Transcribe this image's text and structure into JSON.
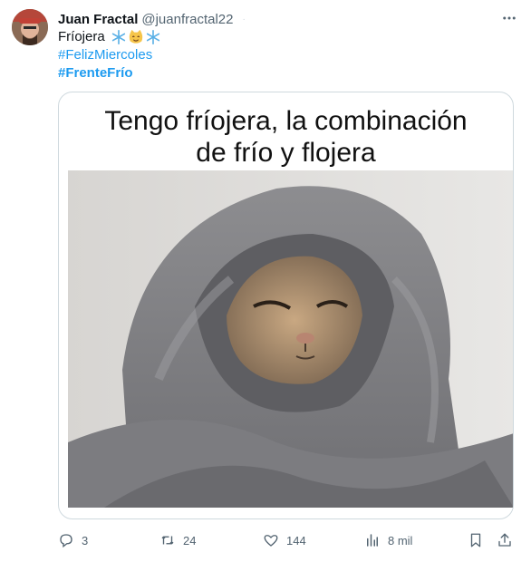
{
  "author": {
    "name": "Juan Fractal",
    "handle": "@juanfractal22"
  },
  "tweet": {
    "text": "Fríojera",
    "hashtags": [
      "#FelizMiercoles",
      "#FrenteFrío"
    ]
  },
  "media": {
    "caption_line1": "Tengo fríojera, la combinación",
    "caption_line2": "de frío y flojera"
  },
  "actions": {
    "replies": "3",
    "retweets": "24",
    "likes": "144",
    "views": "8 mil"
  },
  "icons": {
    "more": "more-dots-icon",
    "reply": "reply-icon",
    "retweet": "retweet-icon",
    "like": "heart-icon",
    "views": "views-chart-icon",
    "bookmark": "bookmark-icon",
    "share": "share-icon"
  },
  "colors": {
    "link": "#1d9bf0",
    "secondary": "#536471",
    "border": "#cfd9de"
  }
}
